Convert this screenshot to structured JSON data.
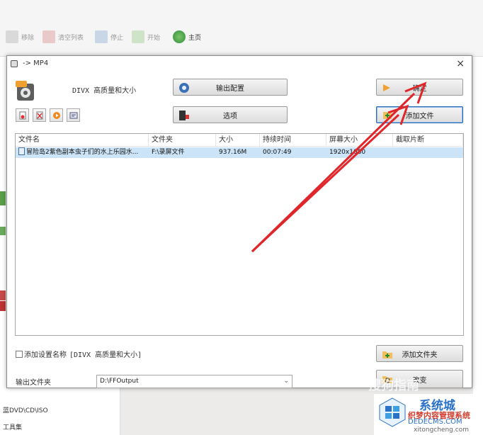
{
  "background": {
    "toolbar": [
      {
        "label": "移除",
        "icon": "remove-icon"
      },
      {
        "label": "清空列表",
        "icon": "clear-list-icon"
      },
      {
        "label": "停止",
        "icon": "stop-icon"
      },
      {
        "label": "开始",
        "icon": "start-icon"
      },
      {
        "label": "主页",
        "icon": "home-icon"
      }
    ],
    "left_panel": [
      "蓝DVD\\CD\\ISO",
      "工具集"
    ]
  },
  "dialog": {
    "title": "-> MP4",
    "profile_label": "DIVX 高质量和大小",
    "buttons": {
      "output_settings": "输出配置",
      "options": "选项",
      "ok": "确定",
      "add_file": "添加文件",
      "add_folder": "添加文件夹",
      "change": "改变"
    },
    "file_list": {
      "columns": [
        "文件名",
        "文件夹",
        "大小",
        "持续时间",
        "屏幕大小",
        "截取片断"
      ],
      "rows": [
        {
          "name": "冒险岛2紫色副本虫子们的水上乐园水...",
          "folder": "F:\\录屏文件",
          "size": "937.16M",
          "duration": "00:07:49",
          "screen_size": "1920x1080",
          "clip": ""
        }
      ]
    },
    "checkbox": {
      "label": "添加设置名称",
      "value": "[DIVX 高质量和大小]",
      "checked": false
    },
    "output_folder": {
      "label": "输出文件夹",
      "value": "D:\\FFOutput"
    }
  },
  "watermark": {
    "sogou": "搜狗指南",
    "site_title": "系统城",
    "site_sub": "织梦内容管理系统",
    "site_url": "DEDECMS.COM",
    "site_domain": "xitongcheng.com"
  },
  "colors": {
    "annotation_arrow": "#e0262b",
    "selected_row": "#cce4f7"
  }
}
